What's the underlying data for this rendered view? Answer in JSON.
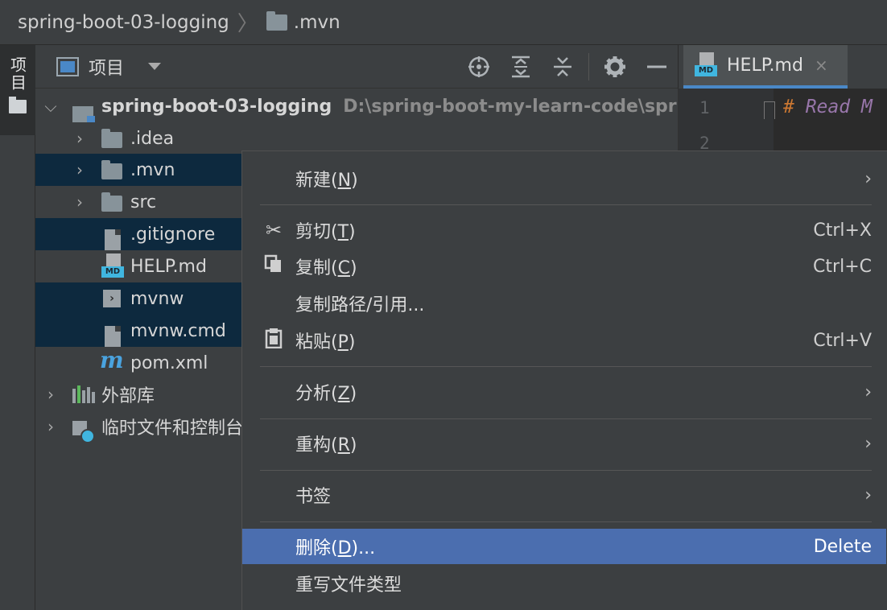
{
  "breadcrumb": {
    "project": "spring-boot-03-logging",
    "folder": ".mvn"
  },
  "toolstrip": {
    "project_tab": "项目"
  },
  "project_panel": {
    "title": "项目",
    "tools": [
      "locate-icon",
      "expand-all-icon",
      "collapse-all-icon",
      "gear-icon",
      "minimize-icon"
    ]
  },
  "editor": {
    "tab_label": "HELP.md",
    "badge": "MD",
    "close_glyph": "×",
    "line_numbers": [
      "1",
      "2"
    ],
    "code_hash": "#",
    "code_text": " Read M"
  },
  "tree": {
    "root": {
      "name": "spring-boot-03-logging",
      "path": "D:\\spring-boot-my-learn-code\\spr"
    },
    "items": [
      {
        "name": ".idea",
        "type": "folder"
      },
      {
        "name": ".mvn",
        "type": "folder"
      },
      {
        "name": "src",
        "type": "folder"
      },
      {
        "name": ".gitignore",
        "type": "file"
      },
      {
        "name": "HELP.md",
        "type": "markdown"
      },
      {
        "name": "mvnw",
        "type": "script"
      },
      {
        "name": "mvnw.cmd",
        "type": "file"
      },
      {
        "name": "pom.xml",
        "type": "maven"
      }
    ],
    "external_libs": "外部库",
    "scratches": "临时文件和控制台"
  },
  "context_menu": {
    "new": {
      "label": "新建(",
      "mnemonic": "N",
      "tail": ")"
    },
    "cut": {
      "label": "剪切(",
      "mnemonic": "T",
      "tail": ")",
      "shortcut": "Ctrl+X"
    },
    "copy": {
      "label": "复制(",
      "mnemonic": "C",
      "tail": ")",
      "shortcut": "Ctrl+C"
    },
    "copy_path": {
      "label": "复制路径/引用..."
    },
    "paste": {
      "label": "粘贴(",
      "mnemonic": "P",
      "tail": ")",
      "shortcut": "Ctrl+V"
    },
    "analyze": {
      "label": "分析(",
      "mnemonic": "Z",
      "tail": ")"
    },
    "refactor": {
      "label": "重构(",
      "mnemonic": "R",
      "tail": ")"
    },
    "bookmarks": {
      "label": "书签"
    },
    "delete": {
      "label": "删除(",
      "mnemonic": "D",
      "tail": ")...",
      "shortcut": "Delete"
    },
    "override_type": {
      "label": "重写文件类型"
    }
  },
  "colors": {
    "background": "#3c3f41",
    "selection": "#0d293e",
    "menu_highlight": "#4b6eaf",
    "accent": "#4a88c7"
  }
}
